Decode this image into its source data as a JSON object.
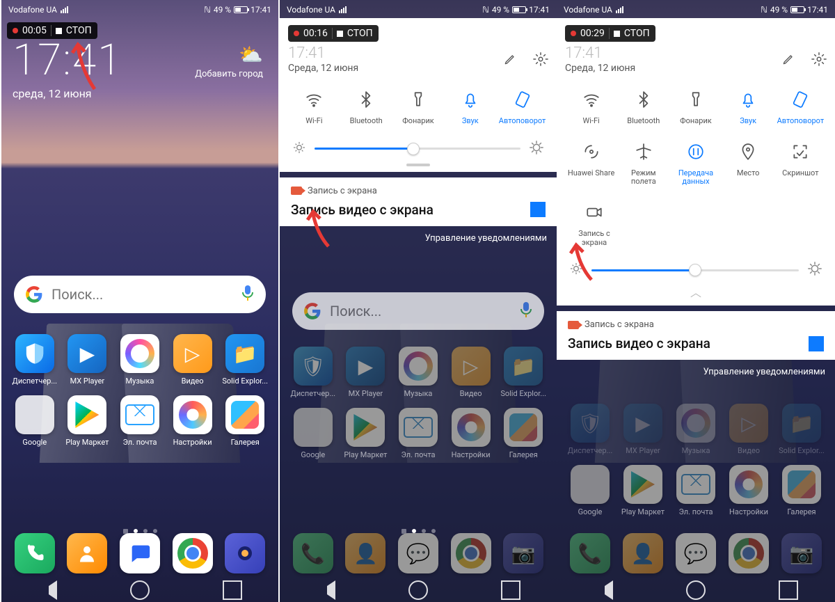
{
  "status": {
    "carrier": "Vodafone UA",
    "nfc": "ℕ",
    "battery_pct": "49 %",
    "time": "17:41"
  },
  "recording": {
    "t1": "00:05",
    "t2": "00:16",
    "t3": "00:29",
    "stop": "СТОП"
  },
  "clock": {
    "time": "17:41",
    "date": "среда, 12 июня",
    "addcity": "Добавить город"
  },
  "search": {
    "placeholder": "Поиск..."
  },
  "apps_row1": [
    {
      "label": "Диспетчер..."
    },
    {
      "label": "MX Player"
    },
    {
      "label": "Музыка"
    },
    {
      "label": "Видео"
    },
    {
      "label": "Solid Explor..."
    }
  ],
  "apps_row2": [
    {
      "label": "Google"
    },
    {
      "label": "Play Маркет"
    },
    {
      "label": "Эл. почта"
    },
    {
      "label": "Настройки"
    },
    {
      "label": "Галерея"
    }
  ],
  "panel": {
    "time": "17:41",
    "date": "Среда, 12 июня",
    "qs1": [
      {
        "label": "Wi-Fi"
      },
      {
        "label": "Bluetooth"
      },
      {
        "label": "Фонарик"
      },
      {
        "label": "Звук"
      },
      {
        "label": "Автоповорот"
      }
    ],
    "qs2": [
      {
        "label": "Huawei Share"
      },
      {
        "label": "Режим полета"
      },
      {
        "label": "Передача данных"
      },
      {
        "label": "Место"
      },
      {
        "label": "Скриншот"
      }
    ],
    "qs3": {
      "label": "Запись с экрана"
    }
  },
  "notif": {
    "app": "Запись с экрана",
    "title": "Запись видео с экрана",
    "manage": "Управление уведомлениями"
  },
  "brightness": {
    "p2": 48,
    "p3": 50
  }
}
